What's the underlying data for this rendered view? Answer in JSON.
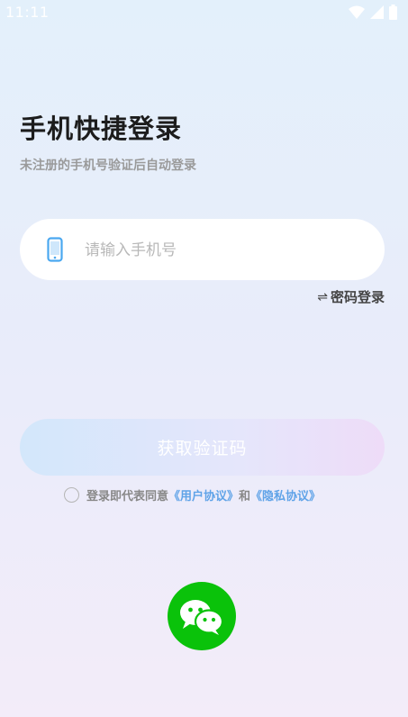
{
  "status_bar": {
    "time": "11:11",
    "icons": [
      "wifi-icon",
      "signal-icon",
      "battery-icon"
    ]
  },
  "header": {
    "title": "手机快捷登录",
    "subtitle": "未注册的手机号验证后自动登录"
  },
  "phone_field": {
    "icon": "phone-icon",
    "value": "",
    "placeholder": "请输入手机号"
  },
  "password_login": {
    "icon": "swap-icon",
    "glyph": "⇌",
    "label": "密码登录"
  },
  "get_code_button": {
    "label": "获取验证码"
  },
  "agreement": {
    "checked": false,
    "prefix": "登录即代表同意",
    "user_agreement": "《用户协议》",
    "connector": "和",
    "privacy_agreement": "《隐私协议》"
  },
  "third_party_login": {
    "icon": "wechat-icon"
  },
  "colors": {
    "brand_wechat": "#0ac20a",
    "link": "#5fa3e8",
    "phone_icon": "#4aa8f0",
    "background_top": "#e3f0fb",
    "background_bottom": "#f3ecf9"
  }
}
